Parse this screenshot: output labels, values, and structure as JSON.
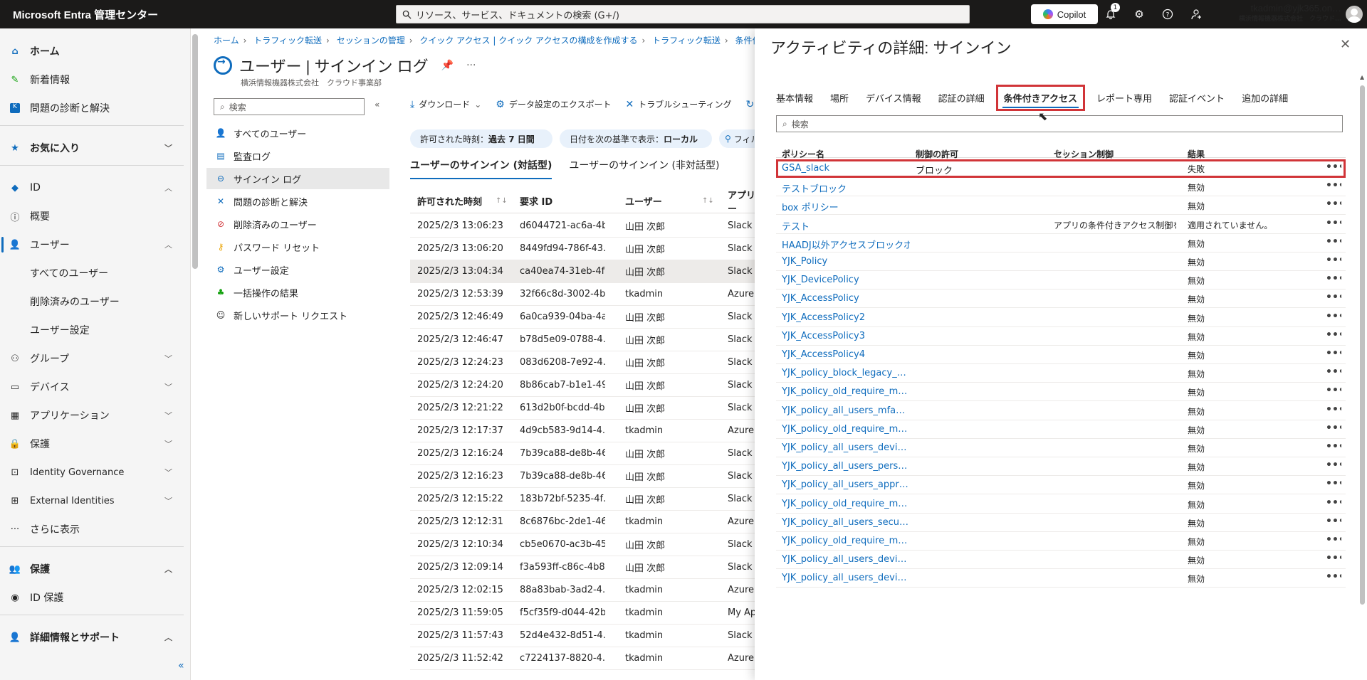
{
  "topbar": {
    "brand": "Microsoft Entra 管理センター",
    "search_placeholder": "リソース、サービス、ドキュメントの検索 (G+/)",
    "copilot": "Copilot",
    "notif_count": "1",
    "account_email": "tkadmin@yjk365.on…",
    "account_org": "横浜情報機器株式会社　クラウド…",
    "icons": [
      "bell-icon",
      "gear-icon",
      "help-icon",
      "feedback-icon"
    ]
  },
  "leftnav": {
    "items": [
      {
        "label": "ホーム",
        "icon": "home-icon",
        "bold": true
      },
      {
        "label": "新着情報",
        "icon": "whats-new-icon"
      },
      {
        "label": "問題の診断と解決",
        "icon": "diagnose-icon"
      },
      {
        "label": "お気に入り",
        "icon": "star-icon",
        "bold": true
      },
      {
        "label": "ID",
        "icon": "identity-icon"
      },
      {
        "label": "概要",
        "icon": "info-icon"
      },
      {
        "label": "ユーザー",
        "icon": "user-icon"
      },
      {
        "label": "すべてのユーザー"
      },
      {
        "label": "削除済みのユーザー"
      },
      {
        "label": "ユーザー設定"
      },
      {
        "label": "グループ",
        "icon": "group-icon"
      },
      {
        "label": "デバイス",
        "icon": "device-icon"
      },
      {
        "label": "アプリケーション",
        "icon": "app-icon"
      },
      {
        "label": "保護",
        "icon": "lock-icon"
      },
      {
        "label": "Identity Governance",
        "icon": "governance-icon"
      },
      {
        "label": "External Identities",
        "icon": "external-icon"
      },
      {
        "label": "さらに表示",
        "icon": "more-icon"
      },
      {
        "label": "保護",
        "icon": "protect-icon",
        "bold": true
      },
      {
        "label": "ID 保護",
        "icon": "id-protect-icon"
      },
      {
        "label": "詳細情報とサポート",
        "icon": "support-icon",
        "bold": true
      }
    ],
    "collapse": "«"
  },
  "blade": {
    "breadcrumb": [
      "ホーム",
      "トラフィック転送",
      "セッションの管理",
      "クイック アクセス | クイック アクセスの構成を作成する",
      "トラフィック転送",
      "条件付きアク"
    ],
    "title": "ユーザー | サインイン ログ",
    "subtitle": "横浜情報機器株式会社　クラウド事業部",
    "more": "···",
    "menu_search": "検索",
    "menu": [
      {
        "label": "すべてのユーザー",
        "icon": "users-icon"
      },
      {
        "label": "監査ログ",
        "icon": "audit-icon"
      },
      {
        "label": "サインイン ログ",
        "icon": "signin-icon",
        "active": true
      },
      {
        "label": "問題の診断と解決",
        "icon": "wrench-icon"
      },
      {
        "label": "削除済みのユーザー",
        "icon": "deleted-user-icon"
      },
      {
        "label": "パスワード リセット",
        "icon": "key-icon"
      },
      {
        "label": "ユーザー設定",
        "icon": "settings-icon"
      },
      {
        "label": "一括操作の結果",
        "icon": "bulk-icon"
      },
      {
        "label": "新しいサポート リクエスト",
        "icon": "support-request-icon"
      }
    ],
    "toolbar": {
      "download": "ダウンロード",
      "export": "データ設定のエクスポート",
      "troubleshoot": "トラブルシューティング",
      "refresh": "更新"
    },
    "filters": [
      {
        "label": "許可された時刻：",
        "value": "過去 7 日間"
      },
      {
        "label": "日付を次の基準で表示：",
        "value": "ローカル"
      },
      {
        "label": "フィル",
        "value": ""
      }
    ],
    "tabs": [
      "ユーザーのサインイン (対話型)",
      "ユーザーのサインイン (非対話型)"
    ],
    "columns": [
      "許可された時刻",
      "要求 ID",
      "ユーザー",
      "アプリケー"
    ],
    "rows": [
      [
        "2025/2/3 13:06:23",
        "d6044721-ac6a-4b…",
        "山田 次郎",
        "Slack"
      ],
      [
        "2025/2/3 13:06:20",
        "8449fd94-786f-43…",
        "山田 次郎",
        "Slack"
      ],
      [
        "2025/2/3 13:04:34",
        "ca40ea74-31eb-4f…",
        "山田 次郎",
        "Slack"
      ],
      [
        "2025/2/3 12:53:39",
        "32f66c8d-3002-4b…",
        "tkadmin",
        "Azure"
      ],
      [
        "2025/2/3 12:46:49",
        "6a0ca939-04ba-4a…",
        "山田 次郎",
        "Slack"
      ],
      [
        "2025/2/3 12:46:47",
        "b78d5e09-0788-4…",
        "山田 次郎",
        "Slack"
      ],
      [
        "2025/2/3 12:24:23",
        "083d6208-7e92-4…",
        "山田 次郎",
        "Slack"
      ],
      [
        "2025/2/3 12:24:20",
        "8b86cab7-b1e1-49…",
        "山田 次郎",
        "Slack"
      ],
      [
        "2025/2/3 12:21:22",
        "613d2b0f-bcdd-4b…",
        "山田 次郎",
        "Slack"
      ],
      [
        "2025/2/3 12:17:37",
        "4d9cb583-9d14-4…",
        "tkadmin",
        "Azure"
      ],
      [
        "2025/2/3 12:16:24",
        "7b39ca88-de8b-46…",
        "山田 次郎",
        "Slack"
      ],
      [
        "2025/2/3 12:16:23",
        "7b39ca88-de8b-46…",
        "山田 次郎",
        "Slack"
      ],
      [
        "2025/2/3 12:15:22",
        "183b72bf-5235-4f…",
        "山田 次郎",
        "Slack"
      ],
      [
        "2025/2/3 12:12:31",
        "8c6876bc-2de1-46…",
        "tkadmin",
        "Azure"
      ],
      [
        "2025/2/3 12:10:34",
        "cb5e0670-ac3b-45…",
        "山田 次郎",
        "Slack"
      ],
      [
        "2025/2/3 12:09:14",
        "f3a593ff-c86c-4b8…",
        "山田 次郎",
        "Slack"
      ],
      [
        "2025/2/3 12:02:15",
        "88a83bab-3ad2-4…",
        "tkadmin",
        "Azure"
      ],
      [
        "2025/2/3 11:59:05",
        "f5cf35f9-d044-42b…",
        "tkadmin",
        "My Ap"
      ],
      [
        "2025/2/3 11:57:43",
        "52d4e432-8d51-4…",
        "tkadmin",
        "Slack"
      ],
      [
        "2025/2/3 11:52:42",
        "c7224137-8820-4…",
        "tkadmin",
        "Azure"
      ]
    ]
  },
  "panel": {
    "title": "アクティビティの詳細: サインイン",
    "close": "✕",
    "tabs": [
      "基本情報",
      "場所",
      "デバイス情報",
      "認証の詳細",
      "条件付きアクセス",
      "レポート専用",
      "認証イベント",
      "追加の詳細"
    ],
    "active_tab": 4,
    "search_placeholder": "検索",
    "columns": [
      "ポリシー名",
      "制御の許可",
      "セッション制御",
      "結果"
    ],
    "rows": [
      [
        "GSA_slack",
        "ブロック",
        "",
        "失敗"
      ],
      [
        "テストブロック",
        "",
        "",
        "無効"
      ],
      [
        "box ポリシー",
        "",
        "",
        "無効"
      ],
      [
        "テスト",
        "",
        "アプリの条件付きアクセス制御を…",
        "適用されていません。"
      ],
      [
        "HAADJ以外アクセスブロックポリ…",
        "",
        "",
        "無効"
      ],
      [
        "YJK_Policy",
        "",
        "",
        "無効"
      ],
      [
        "YJK_DevicePolicy",
        "",
        "",
        "無効"
      ],
      [
        "YJK_AccessPolicy",
        "",
        "",
        "無効"
      ],
      [
        "YJK_AccessPolicy2",
        "",
        "",
        "無効"
      ],
      [
        "YJK_AccessPolicy3",
        "",
        "",
        "無効"
      ],
      [
        "YJK_AccessPolicy4",
        "",
        "",
        "無効"
      ],
      [
        "YJK_policy_block_legacy_…",
        "",
        "",
        "無効"
      ],
      [
        "YJK_policy_old_require_m…",
        "",
        "",
        "無効"
      ],
      [
        "YJK_policy_all_users_mfa…",
        "",
        "",
        "無効"
      ],
      [
        "YJK_policy_old_require_m…",
        "",
        "",
        "無効"
      ],
      [
        "YJK_policy_all_users_devi…",
        "",
        "",
        "無効"
      ],
      [
        "YJK_policy_all_users_pers…",
        "",
        "",
        "無効"
      ],
      [
        "YJK_policy_all_users_appr…",
        "",
        "",
        "無効"
      ],
      [
        "YJK_policy_old_require_m…",
        "",
        "",
        "無効"
      ],
      [
        "YJK_policy_all_users_secu…",
        "",
        "",
        "無効"
      ],
      [
        "YJK_policy_old_require_m…",
        "",
        "",
        "無効"
      ],
      [
        "YJK_policy_all_users_devi…",
        "",
        "",
        "無効"
      ],
      [
        "YJK_policy_all_users_devi…",
        "",
        "",
        "無効"
      ]
    ],
    "row_menu": "•••",
    "highlight_color": "#d13438"
  }
}
